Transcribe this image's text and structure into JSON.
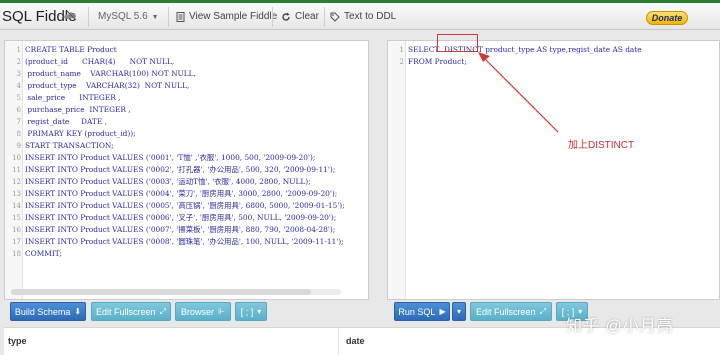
{
  "topbar": {
    "logo": "SQL Fiddle",
    "logo_icon": "fiddle-icon",
    "db_select": "MySQL 5.6",
    "view_sample": "View Sample Fiddle",
    "clear": "Clear",
    "text_to_ddl": "Text to DDL",
    "donate": "Donate"
  },
  "schema_panel": {
    "lines": [
      {
        "n": "1",
        "t": "CREATE TABLE Product"
      },
      {
        "n": "2",
        "t": "(product_id      CHAR(4)      NOT NULL,"
      },
      {
        "n": "3",
        "t": " product_name    VARCHAR(100) NOT NULL,"
      },
      {
        "n": "4",
        "t": " product_type    VARCHAR(32)  NOT NULL,"
      },
      {
        "n": "5",
        "t": " sale_price      INTEGER ,"
      },
      {
        "n": "6",
        "t": " purchase_price  INTEGER ,"
      },
      {
        "n": "7",
        "t": " regist_date     DATE ,"
      },
      {
        "n": "8",
        "t": " PRIMARY KEY (product_id));"
      },
      {
        "n": "9",
        "t": "START TRANSACTION;"
      },
      {
        "n": "10",
        "t": "INSERT INTO Product VALUES ('0001', 'T恤' ,'衣服', 1000, 500, '2009-09-20');"
      },
      {
        "n": "11",
        "t": "INSERT INTO Product VALUES ('0002', '打孔器', '办公用品', 500, 320, '2009-09-11');"
      },
      {
        "n": "12",
        "t": "INSERT INTO Product VALUES ('0003', '运动T恤', '衣服', 4000, 2800, NULL);"
      },
      {
        "n": "13",
        "t": "INSERT INTO Product VALUES ('0004', '菜刀', '厨房用具', 3000, 2800, '2009-09-20');"
      },
      {
        "n": "14",
        "t": "INSERT INTO Product VALUES ('0005', '高压锅', '厨房用具', 6800, 5000, '2009-01-15');"
      },
      {
        "n": "15",
        "t": "INSERT INTO Product VALUES ('0006', '叉子', '厨房用具', 500, NULL, '2009-09-20');"
      },
      {
        "n": "16",
        "t": "INSERT INTO Product VALUES ('0007', '擦菜板', '厨房用具', 880, 790, '2008-04-28');"
      },
      {
        "n": "17",
        "t": "INSERT INTO Product VALUES ('0008', '圆珠笔', '办公用品', 100, NULL, '2009-11-11');"
      },
      {
        "n": "18",
        "t": "COMMIT;"
      }
    ]
  },
  "query_panel": {
    "lines": [
      {
        "n": "1",
        "t": "SELECT  DISTINCT product_type AS type,regist_date AS date"
      },
      {
        "n": "2",
        "t": "FROM Product;"
      }
    ]
  },
  "annotation": {
    "text": "加上DISTINCT",
    "color": "#c93030"
  },
  "schema_buttons": {
    "build": "Build Schema",
    "edit_fullscreen": "Edit Fullscreen",
    "browser": "Browser",
    "separator": "[ ; ]"
  },
  "query_buttons": {
    "run": "Run SQL",
    "edit_fullscreen": "Edit Fullscreen",
    "separator": "[ ; ]"
  },
  "results": {
    "columns": [
      "type",
      "date"
    ]
  },
  "watermark": "知乎 @小月亮",
  "colors": {
    "accent_green": "#2f7d2f",
    "button_blue": "#2d6bb6",
    "button_teal": "#5ab0c9",
    "code_text": "#2a2aa6"
  }
}
